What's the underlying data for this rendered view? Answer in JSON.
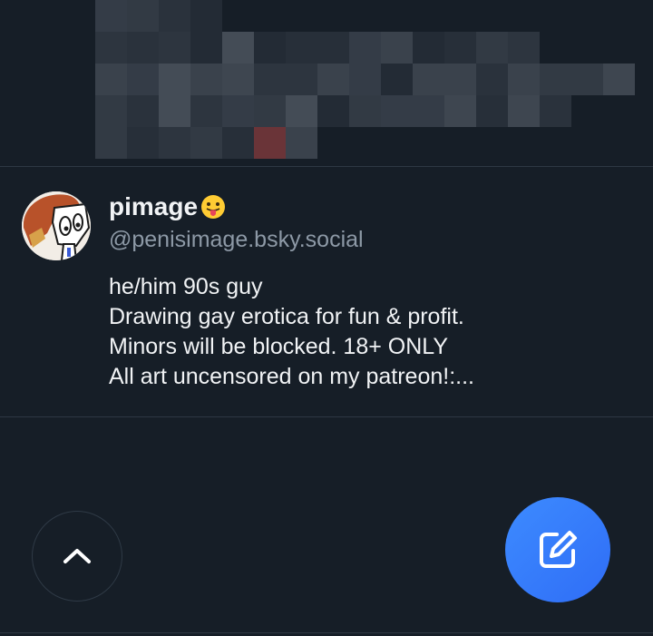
{
  "profile": {
    "display_name": "pimage",
    "handle": "@penisimage.bsky.social",
    "bio_lines": [
      "he/him 90s guy",
      "Drawing gay erotica for fun & profit.",
      "Minors will be blocked. 18+ ONLY",
      "All art uncensored on my patreon!:..."
    ]
  },
  "icons": {
    "name_emoji": "face-with-tongue-icon",
    "scroll_top": "chevron-up-icon",
    "compose": "compose-icon"
  },
  "colors": {
    "background": "#161e27",
    "accent": "#3d8bff",
    "secondary_text": "#8d99a6"
  }
}
